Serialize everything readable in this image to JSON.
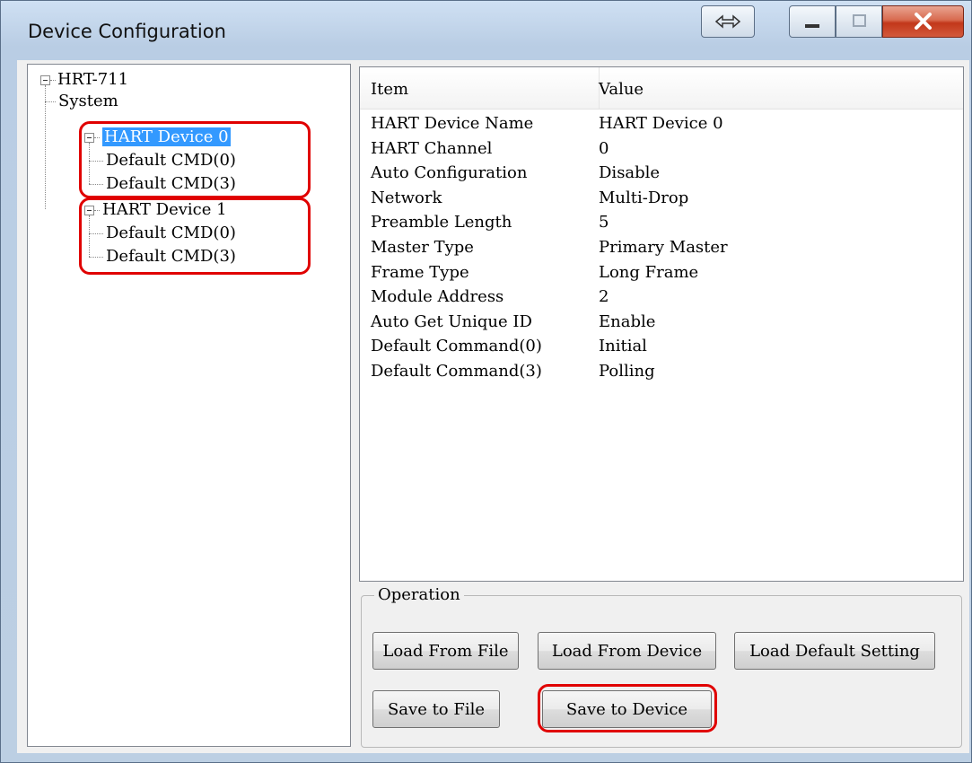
{
  "window": {
    "title": "Device Configuration"
  },
  "tree": {
    "root": "HRT-711",
    "system": "System",
    "device0": "HART Device 0",
    "device0_cmd0": "Default CMD(0)",
    "device0_cmd3": "Default CMD(3)",
    "device1": "HART Device 1",
    "device1_cmd0": "Default CMD(0)",
    "device1_cmd3": "Default CMD(3)"
  },
  "list": {
    "columns": [
      "Item",
      "Value"
    ],
    "rows": [
      {
        "item": "HART Device Name",
        "value": "HART Device 0"
      },
      {
        "item": "HART Channel",
        "value": "0"
      },
      {
        "item": "Auto Configuration",
        "value": "Disable"
      },
      {
        "item": "Network",
        "value": "Multi-Drop"
      },
      {
        "item": "Preamble Length",
        "value": "5"
      },
      {
        "item": "Master Type",
        "value": "Primary Master"
      },
      {
        "item": "Frame Type",
        "value": "Long Frame"
      },
      {
        "item": "Module Address",
        "value": "2"
      },
      {
        "item": "Auto Get Unique ID",
        "value": "Enable"
      },
      {
        "item": "Default Command(0)",
        "value": "Initial"
      },
      {
        "item": "Default Command(3)",
        "value": "Polling"
      }
    ]
  },
  "operation": {
    "title": "Operation",
    "load_from_file": "Load From File",
    "load_from_device": "Load From Device",
    "load_default": "Load Default Setting",
    "save_to_file": "Save to File",
    "save_to_device": "Save to Device"
  },
  "colors": {
    "highlight": "#e00000",
    "selection": "#3399ff"
  }
}
